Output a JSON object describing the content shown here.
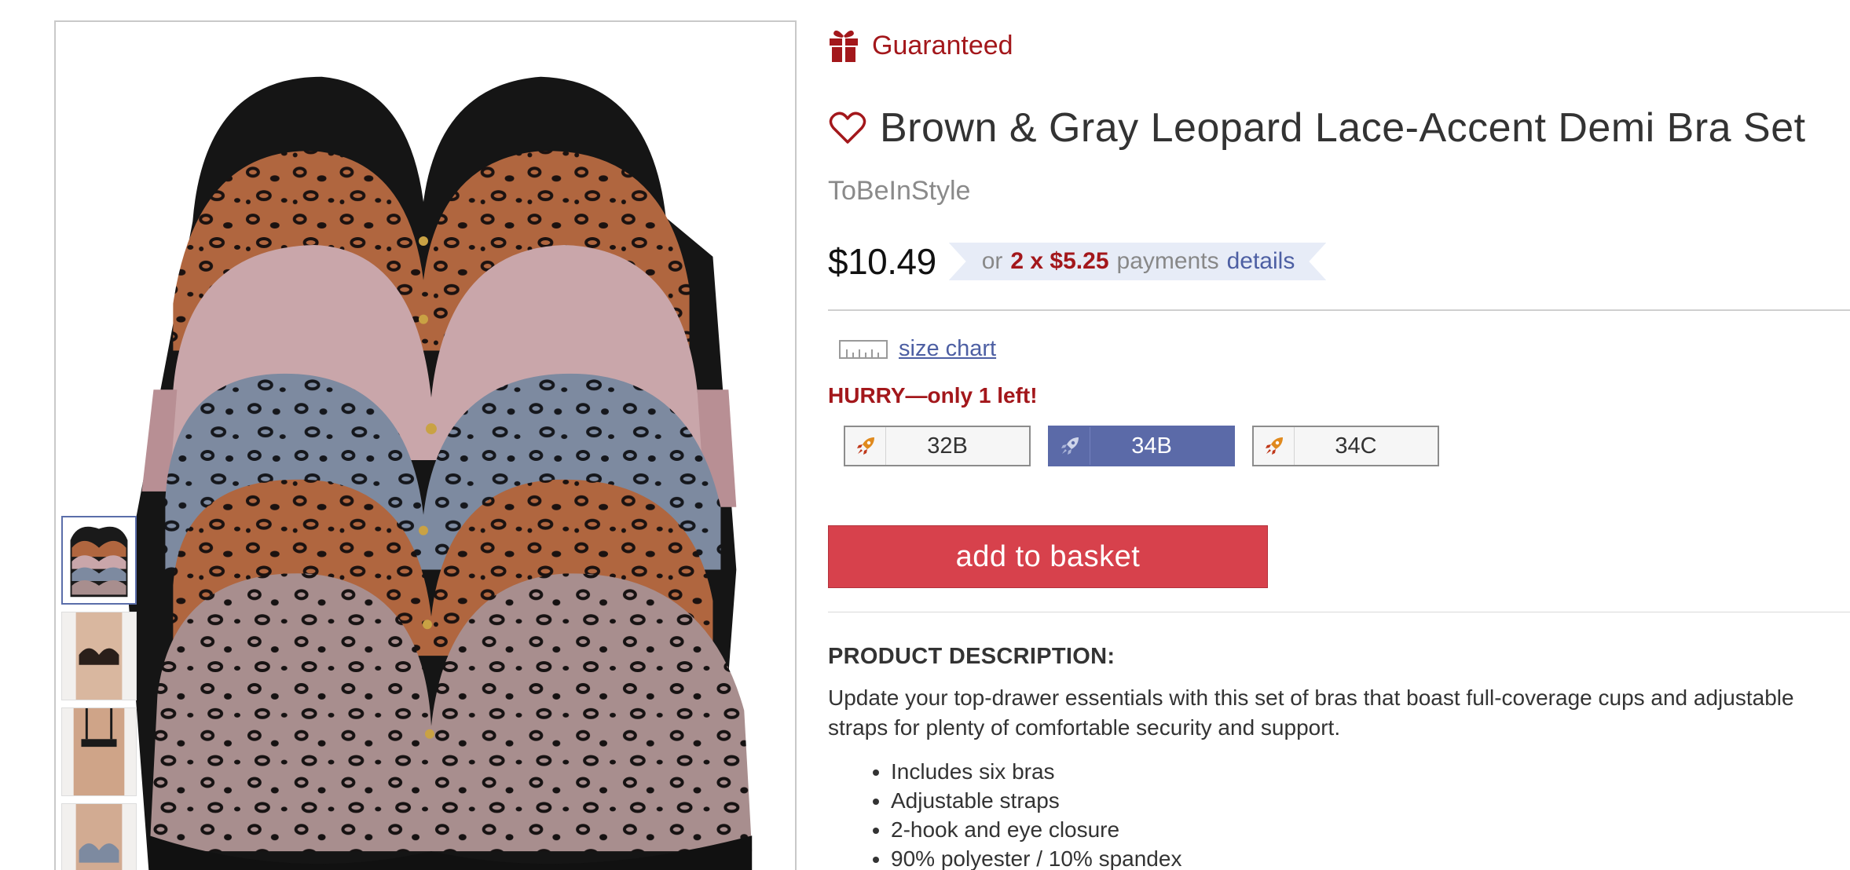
{
  "badge": {
    "label": "Guaranteed",
    "icon": "gift-icon",
    "color": "#a3171b"
  },
  "product": {
    "title": "Brown & Gray Leopard Lace-Accent Demi Bra Set",
    "brand": "ToBeInStyle",
    "price": "$10.49"
  },
  "payments": {
    "prefix": "or",
    "amount": "2 x $5.25",
    "word": "payments",
    "link": "details"
  },
  "size_chart": {
    "label": "size chart",
    "icon": "ruler-icon"
  },
  "stock_alert": "HURRY—only 1 left!",
  "sizes": [
    {
      "label": "32B",
      "selected": false
    },
    {
      "label": "34B",
      "selected": true
    },
    {
      "label": "34C",
      "selected": false
    }
  ],
  "cart": {
    "label": "add to basket"
  },
  "description": {
    "heading": "PRODUCT DESCRIPTION:",
    "text": "Update your top-drawer essentials with this set of bras that boast full-coverage cups and adjustable straps for plenty of comfortable security and support.",
    "bullets": [
      "Includes six bras",
      "Adjustable straps",
      "2-hook and eye closure",
      "90% polyester / 10% spandex"
    ]
  },
  "colors": {
    "accent": "#a3171b",
    "selected_size": "#5b6aa8",
    "add_button": "#d7414c",
    "link": "#4d5fa3"
  }
}
